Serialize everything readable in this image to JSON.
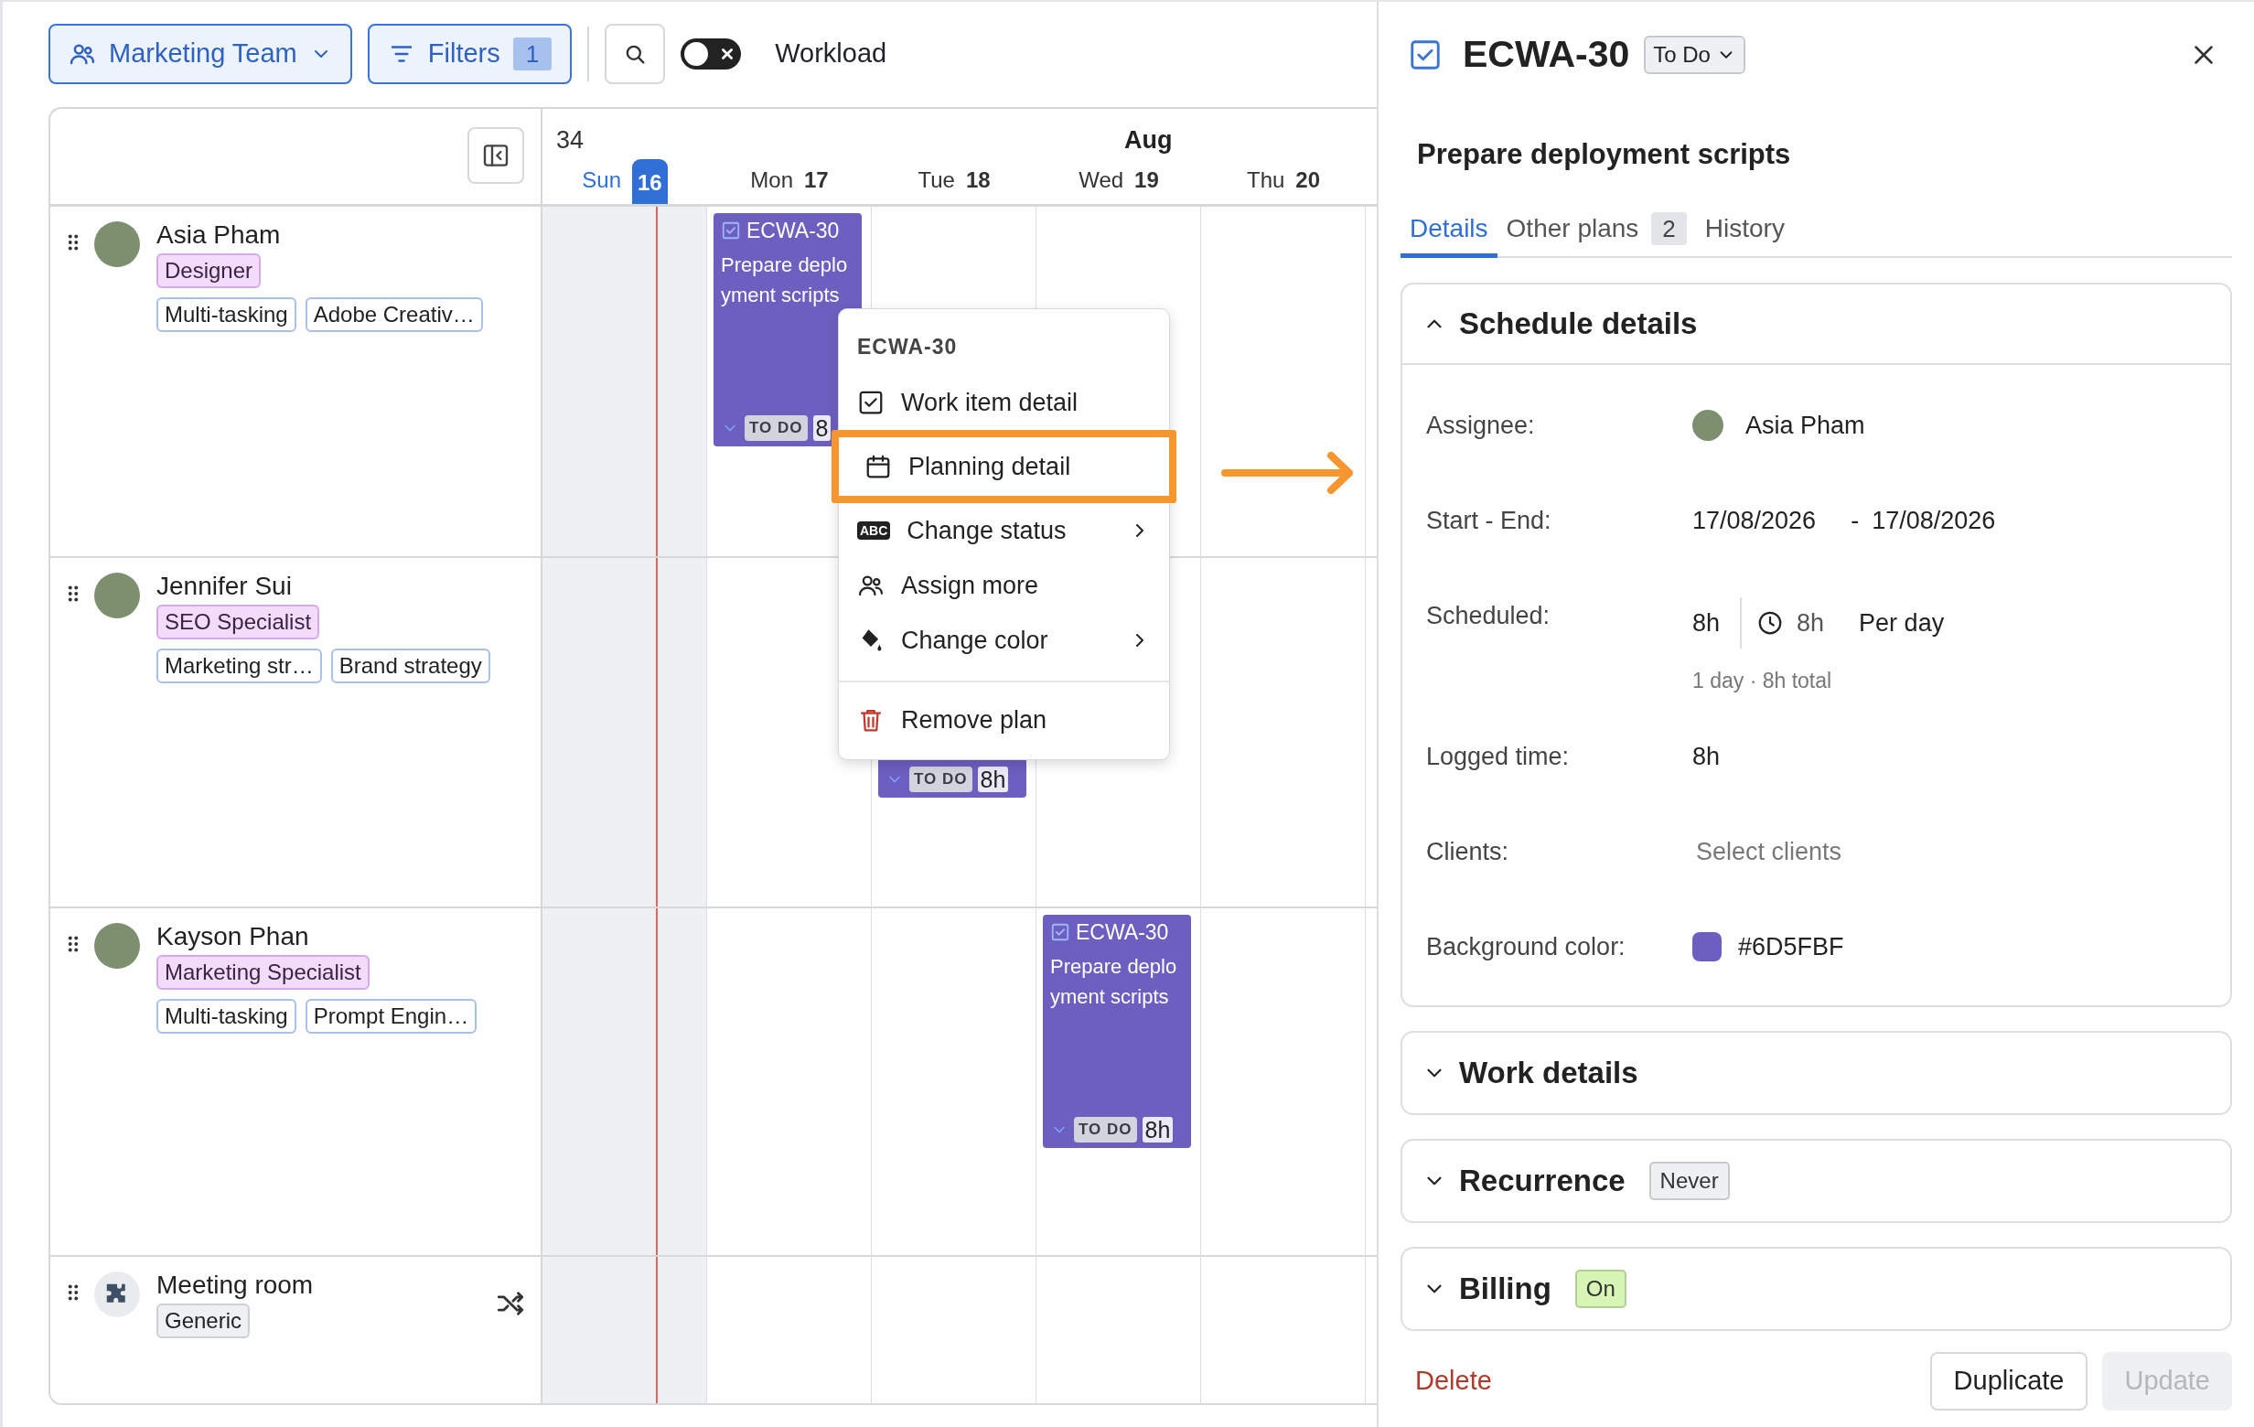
{
  "toolbar": {
    "team_button": {
      "label": "Marketing Team"
    },
    "filters_button": {
      "label": "Filters",
      "count": "1"
    },
    "workload_toggle": {
      "label": "Workload",
      "on": false
    }
  },
  "calendar": {
    "week": "34",
    "month": "Aug",
    "days": [
      {
        "weekday": "Sun",
        "date": "16",
        "today": true,
        "weekend": true
      },
      {
        "weekday": "Mon",
        "date": "17",
        "today": false,
        "weekend": false
      },
      {
        "weekday": "Tue",
        "date": "18",
        "today": false,
        "weekend": false
      },
      {
        "weekday": "Wed",
        "date": "19",
        "today": false,
        "weekend": false
      },
      {
        "weekday": "Thu",
        "date": "20",
        "today": false,
        "weekend": false
      }
    ],
    "resources": [
      {
        "name": "Asia Pham",
        "kind": "person",
        "tags": [
          {
            "label": "Designer",
            "kind": "role"
          },
          {
            "label": "Multi-tasking",
            "kind": "skill"
          },
          {
            "label": "Adobe Creativ…",
            "kind": "skill"
          }
        ],
        "cells": [
          null,
          {
            "id": "ECWA-30",
            "title": "Prepare deployment scripts",
            "status": "TO DO",
            "hours": "8"
          },
          null,
          null,
          null
        ]
      },
      {
        "name": "Jennifer Sui",
        "kind": "person",
        "tags": [
          {
            "label": "SEO Specialist",
            "kind": "role"
          },
          {
            "label": "Marketing str…",
            "kind": "skill"
          },
          {
            "label": "Brand strategy",
            "kind": "skill"
          }
        ],
        "cells": [
          null,
          null,
          {
            "status": "TO DO",
            "hours": "8h"
          },
          null,
          null
        ]
      },
      {
        "name": "Kayson Phan",
        "kind": "person",
        "tags": [
          {
            "label": "Marketing Specialist",
            "kind": "role"
          },
          {
            "label": "Multi-tasking",
            "kind": "skill"
          },
          {
            "label": "Prompt Engin…",
            "kind": "skill"
          }
        ],
        "cells": [
          null,
          null,
          null,
          {
            "id": "ECWA-30",
            "title": "Prepare deployment scripts",
            "status": "TO DO",
            "hours": "8h"
          },
          null
        ]
      },
      {
        "name": "Meeting room",
        "kind": "room",
        "tags": [
          {
            "label": "Generic",
            "kind": "generic"
          }
        ],
        "cells": [
          null,
          null,
          null,
          null,
          null
        ]
      }
    ]
  },
  "context_menu": {
    "title": "ECWA-30",
    "items": [
      {
        "label": "Work item detail",
        "kind": "action",
        "highlighted": false
      },
      {
        "label": "Planning detail",
        "kind": "action",
        "highlighted": true
      },
      {
        "label": "Change status",
        "kind": "submenu",
        "icon_label": "ABC",
        "highlighted": false
      },
      {
        "label": "Assign more",
        "kind": "action",
        "highlighted": false
      },
      {
        "label": "Change color",
        "kind": "submenu",
        "highlighted": false
      },
      {
        "label": "Remove plan",
        "kind": "danger",
        "highlighted": false
      }
    ]
  },
  "panel": {
    "id": "ECWA-30",
    "status": "To Do",
    "title": "Prepare deployment scripts",
    "tabs": [
      {
        "label": "Details",
        "selected": true
      },
      {
        "label": "Other plans",
        "count": "2",
        "selected": false
      },
      {
        "label": "History",
        "selected": false
      }
    ],
    "sections": [
      {
        "title": "Schedule details",
        "expanded": true,
        "fields": [
          {
            "kind": "assignee",
            "label": "Assignee:",
            "value": "Asia Pham"
          },
          {
            "kind": "range",
            "label": "Start - End:",
            "start": "17/08/2026",
            "separator": "-",
            "end": "17/08/2026"
          },
          {
            "kind": "scheduled",
            "label": "Scheduled:",
            "value": "8h",
            "duration": "8h",
            "period": "Per day",
            "note": "1 day · 8h total"
          },
          {
            "kind": "text",
            "label": "Logged time:",
            "value": "8h"
          },
          {
            "kind": "select",
            "label": "Clients:",
            "placeholder": "Select clients"
          },
          {
            "kind": "color",
            "label": "Background color:",
            "value": "#6D5FBF",
            "color": "#6d5fbf"
          }
        ]
      },
      {
        "title": "Work details",
        "expanded": false
      },
      {
        "title": "Recurrence",
        "expanded": false,
        "badge": "Never",
        "color": "#eef0f2"
      },
      {
        "title": "Billing",
        "expanded": false,
        "badge": "On",
        "color": "#d7f5b5"
      }
    ],
    "actions": {
      "delete": "Delete",
      "duplicate": "Duplicate",
      "update": {
        "label": "Update",
        "disabled": true
      }
    }
  }
}
